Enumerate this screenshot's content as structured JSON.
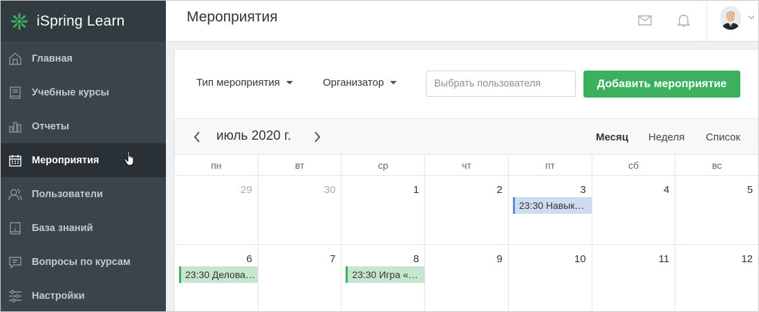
{
  "app": {
    "name": "iSpring Learn"
  },
  "sidebar": {
    "items": [
      {
        "label": "Главная",
        "icon": "home-icon"
      },
      {
        "label": "Учебные курсы",
        "icon": "book-icon"
      },
      {
        "label": "Отчеты",
        "icon": "bar-chart-icon"
      },
      {
        "label": "Мероприятия",
        "icon": "calendar-icon",
        "active": true
      },
      {
        "label": "Пользователи",
        "icon": "users-icon"
      },
      {
        "label": "База знаний",
        "icon": "knowledge-icon"
      },
      {
        "label": "Вопросы по курсам",
        "icon": "chat-icon"
      },
      {
        "label": "Настройки",
        "icon": "sliders-icon"
      }
    ]
  },
  "header": {
    "title": "Мероприятия",
    "icons": [
      "mail-icon",
      "bell-icon",
      "avatar",
      "chevron-down-icon"
    ]
  },
  "filters": {
    "event_type": "Тип мероприятия",
    "organizer": "Организатор",
    "user_placeholder": "Выбрать пользователя",
    "add_button": "Добавить мероприятие"
  },
  "calendar": {
    "month_label": "июль 2020 г.",
    "views": [
      "Месяц",
      "Неделя",
      "Список"
    ],
    "active_view": "Месяц",
    "weekdays": [
      "пн",
      "вт",
      "ср",
      "чт",
      "пт",
      "сб",
      "вс"
    ],
    "weeks": [
      [
        {
          "day": "29",
          "other": true
        },
        {
          "day": "30",
          "other": true
        },
        {
          "day": "1"
        },
        {
          "day": "2"
        },
        {
          "day": "3",
          "event": "23:30 Навык…",
          "event_color": "blue"
        },
        {
          "day": "4"
        },
        {
          "day": "5"
        }
      ],
      [
        {
          "day": "6",
          "event": "23:30 Делова…",
          "event_color": "green"
        },
        {
          "day": "7"
        },
        {
          "day": "8",
          "event": "23:30 Игра «…",
          "event_color": "green"
        },
        {
          "day": "9"
        },
        {
          "day": "10"
        },
        {
          "day": "11"
        },
        {
          "day": "12"
        }
      ]
    ]
  },
  "colors": {
    "sidebar_bg": "#3a444a",
    "sidebar_active": "#2a3136",
    "accent_green": "#3bb160",
    "event_blue": "#cddcee",
    "event_green": "#c7e6cf"
  }
}
